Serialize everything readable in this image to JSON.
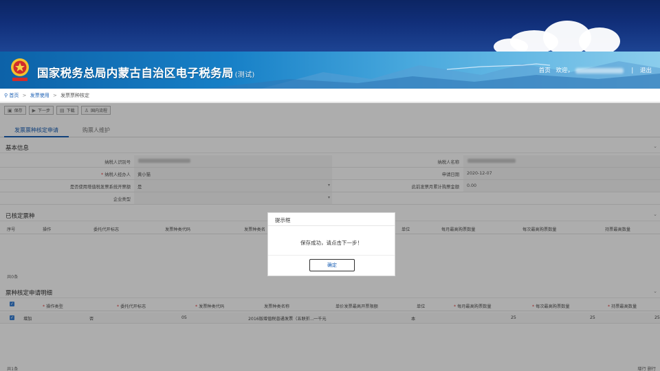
{
  "header": {
    "title": "国家税务总局内蒙古自治区电子税务局",
    "title_suffix": "(测试)",
    "home_link": "首页",
    "welcome": "欢迎，",
    "logout": "退出",
    "separator": "|"
  },
  "breadcrumb": {
    "items": [
      "首页",
      "发票使用",
      "发票票种核定"
    ],
    "separator": ">"
  },
  "toolbar": {
    "save": "保存",
    "next": "下一步",
    "download": "下载",
    "print": "国内流程"
  },
  "tabs": [
    "发票票种核定申请",
    "购票人维护"
  ],
  "basic_info": {
    "section_title": "基本信息",
    "fields": {
      "taxpayer_id_label": "纳税人识别号",
      "taxpayer_name_label": "纳税人名称",
      "handler_label": "纳税人经办人",
      "handler_value": "黄小猫",
      "apply_date_label": "申请日期",
      "apply_date_value": "2020-12-07",
      "use_system_label": "是否使用增值税发票系统开票额",
      "use_system_value": "是",
      "prev_amount_label": "此前发票月累计购票金额",
      "prev_amount_value": "0.00",
      "enterprise_type_label": "企业类型"
    }
  },
  "verified_types": {
    "section_title": "已核定票种",
    "columns": [
      "序号",
      "操作",
      "委托代开标志",
      "发票种类代码",
      "发票种类名",
      "单位",
      "每月最高购票数量",
      "每次最高购票数量",
      "持票最高数量"
    ],
    "footer": "共0条"
  },
  "application_detail": {
    "section_title": "票种核定申请明细",
    "columns": [
      "操作类型",
      "委托代开标志",
      "发票种类代码",
      "发票种类名称",
      "单价发票最高开票限额",
      "单位",
      "每月最高购票数量",
      "每次最高购票数量",
      "持票最高数量"
    ],
    "rows": [
      {
        "op_type": "增加",
        "entrust": "否",
        "code": "05",
        "name": "2016版增值税普通发票（五联折...",
        "limit": "一千元",
        "unit": "本",
        "monthly": "25",
        "per_time": "25",
        "hold": "25"
      }
    ],
    "footer": "共1条",
    "footer_right": "增行 删行"
  },
  "modal": {
    "title": "提示框",
    "message": "保存成功，请点击下一步！",
    "ok": "确定"
  }
}
